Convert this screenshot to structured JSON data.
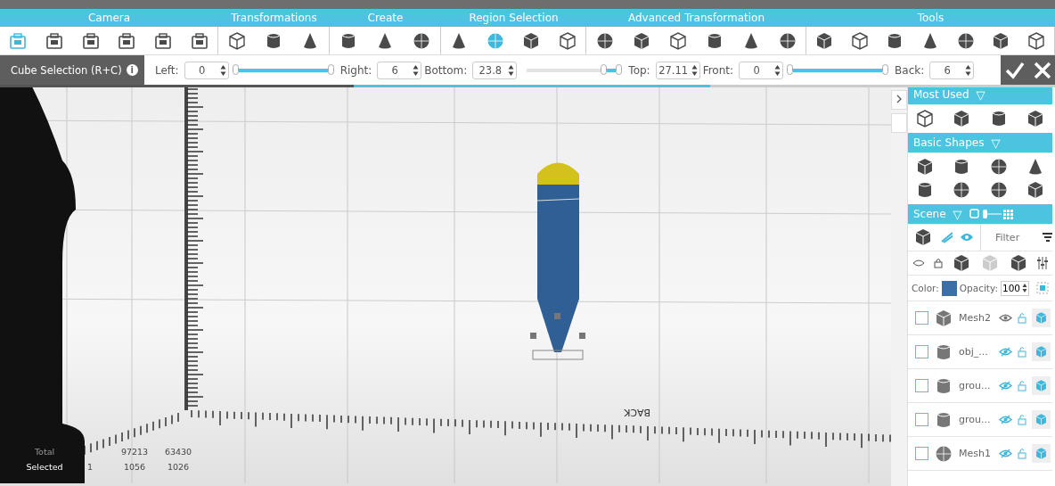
{
  "ribbon": {
    "groups": [
      {
        "label": "Camera",
        "tools": [
          {
            "selected": true
          },
          {
            "selected": false
          },
          {
            "selected": false
          },
          {
            "selected": false
          },
          {
            "selected": false
          },
          {
            "selected": false
          }
        ]
      },
      {
        "label": "Transformations",
        "tools": [
          {
            "selected": false
          },
          {
            "selected": false
          },
          {
            "selected": false
          }
        ]
      },
      {
        "label": "Create",
        "tools": [
          {
            "selected": false
          },
          {
            "selected": false
          },
          {
            "selected": false
          }
        ]
      },
      {
        "label": "Region Selection",
        "tools": [
          {
            "selected": false
          },
          {
            "selected": true
          },
          {
            "selected": false
          },
          {
            "selected": false
          }
        ]
      },
      {
        "label": "Advanced Transformation",
        "tools": [
          {
            "selected": false
          },
          {
            "selected": false
          },
          {
            "selected": false
          },
          {
            "selected": false
          },
          {
            "selected": false
          },
          {
            "selected": false
          }
        ]
      },
      {
        "label": "Tools",
        "tools": [
          {
            "selected": false
          },
          {
            "selected": false
          },
          {
            "selected": false
          },
          {
            "selected": false
          },
          {
            "selected": false
          },
          {
            "selected": false
          },
          {
            "selected": false
          }
        ]
      }
    ]
  },
  "params": {
    "title": "Cube Selection (R+C)",
    "info": "i",
    "items": [
      {
        "kind": "field",
        "label": "Left:",
        "value": "0"
      },
      {
        "kind": "slider",
        "level": 1
      },
      {
        "kind": "field",
        "label": "Right:",
        "value": "6"
      },
      {
        "kind": "field",
        "label": "Bottom:",
        "value": "23.8"
      },
      {
        "kind": "slider",
        "level": 0.1
      },
      {
        "kind": "field",
        "label": "Top:",
        "value": "27.11"
      },
      {
        "kind": "field",
        "label": "Front:",
        "value": "0"
      },
      {
        "kind": "slider",
        "level": 1
      },
      {
        "kind": "field",
        "label": "Back:",
        "value": "6"
      }
    ]
  },
  "viewport": {
    "floor_label": "BACK",
    "stats": [
      {
        "label": "Total",
        "values": [
          "97213",
          "63430"
        ]
      },
      {
        "label": "Selected",
        "values": [
          "1",
          "1056",
          "1026"
        ]
      }
    ]
  },
  "panel": {
    "most_used": {
      "title": "Most Used",
      "toggle": "▽"
    },
    "basic_shapes": {
      "title": "Basic Shapes",
      "toggle": "▽"
    },
    "scene": {
      "title": "Scene",
      "toggle": "▽",
      "filter_placeholder": "Filter",
      "color_label": "Color:",
      "color": "#3a6fa8",
      "opacity_label": "Opacity:",
      "opacity": "100",
      "objects": [
        {
          "name": "Mesh2",
          "checked": false,
          "eye_on": false
        },
        {
          "name": "obj_...",
          "checked": false,
          "eye_on": true
        },
        {
          "name": "grou...",
          "checked": false,
          "eye_on": true
        },
        {
          "name": "grou...",
          "checked": false,
          "eye_on": true
        },
        {
          "name": "Mesh1",
          "checked": false,
          "eye_on": true
        }
      ]
    }
  }
}
